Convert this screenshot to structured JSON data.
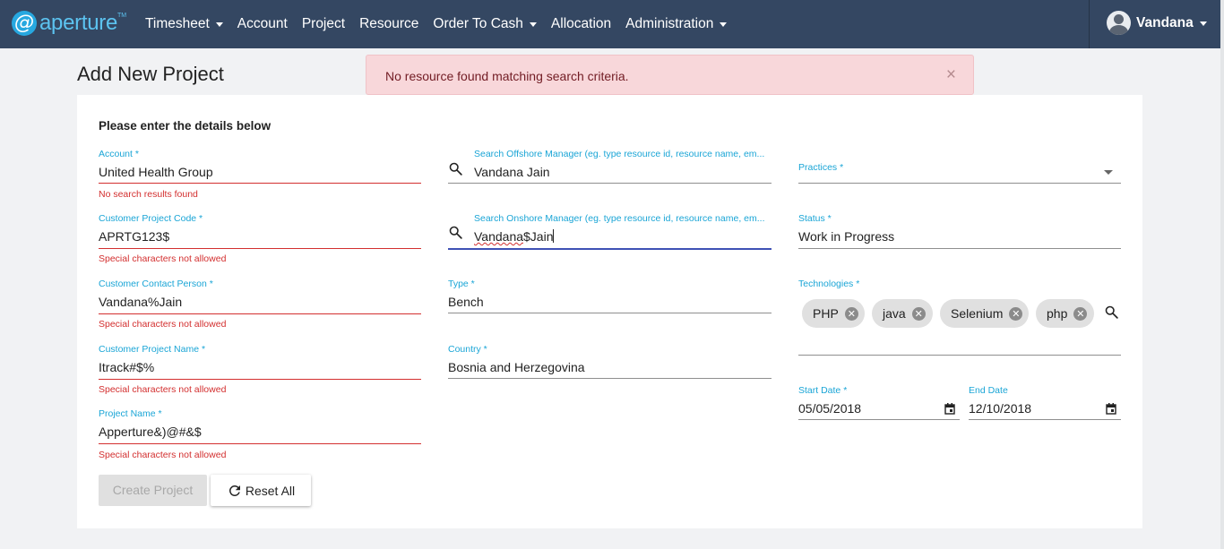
{
  "app": {
    "logo_text": "aperture",
    "logo_glyph": "@",
    "logo_tm": "TM",
    "brand_color": "#27a8e0",
    "navbar_color": "#344762"
  },
  "nav": {
    "items": [
      {
        "label": "Timesheet",
        "dropdown": true
      },
      {
        "label": "Account",
        "dropdown": false
      },
      {
        "label": "Project",
        "dropdown": false
      },
      {
        "label": "Resource",
        "dropdown": false
      },
      {
        "label": "Order To Cash",
        "dropdown": true
      },
      {
        "label": "Allocation",
        "dropdown": false
      },
      {
        "label": "Administration",
        "dropdown": true
      }
    ],
    "user_name": "Vandana"
  },
  "page": {
    "title": "Add New Project",
    "subtitle": "Please enter the details below"
  },
  "alert": {
    "message": "No resource found matching search criteria.",
    "close": "×"
  },
  "form": {
    "account": {
      "label": "Account *",
      "value": "United Health Group",
      "error": "No search results found"
    },
    "customer_project_code": {
      "label": "Customer Project Code *",
      "value": "APRTG123$",
      "error": "Special characters not allowed"
    },
    "customer_contact_person": {
      "label": "Customer Contact Person *",
      "value": "Vandana%Jain",
      "error": "Special characters not allowed"
    },
    "customer_project_name": {
      "label": "Customer Project Name *",
      "value": "Itrack#$%",
      "error": "Special characters not allowed"
    },
    "project_name": {
      "label": "Project Name *",
      "value": "Apperture&)@#&$",
      "error": "Special characters not allowed"
    },
    "offshore_manager": {
      "label": "Search Offshore Manager (eg. type resource id, resource name, em...",
      "value": "Vandana Jain"
    },
    "onshore_manager": {
      "label": "Search Onshore Manager (eg. type resource id, resource name, em...",
      "value_misspelled": "Vandana",
      "value_rest": "$Jain"
    },
    "type": {
      "label": "Type *",
      "value": "Bench"
    },
    "country": {
      "label": "Country *",
      "value": "Bosnia and Herzegovina"
    },
    "practices": {
      "label": "Practices *",
      "value": ""
    },
    "status": {
      "label": "Status *",
      "value": "Work in Progress"
    },
    "technologies": {
      "label": "Technologies *",
      "chips": [
        "PHP",
        "java",
        "Selenium",
        "php"
      ]
    },
    "start_date": {
      "label": "Start Date *",
      "value": "05/05/2018"
    },
    "end_date": {
      "label": "End Date",
      "value": "12/10/2018"
    }
  },
  "buttons": {
    "create": "Create Project",
    "reset": "Reset All"
  },
  "colors": {
    "label_blue": "#1aa5d6",
    "error_red": "#d32f2f",
    "focus_indigo": "#3f51b5",
    "alert_bg": "#f8d7da",
    "alert_text": "#721c24"
  }
}
